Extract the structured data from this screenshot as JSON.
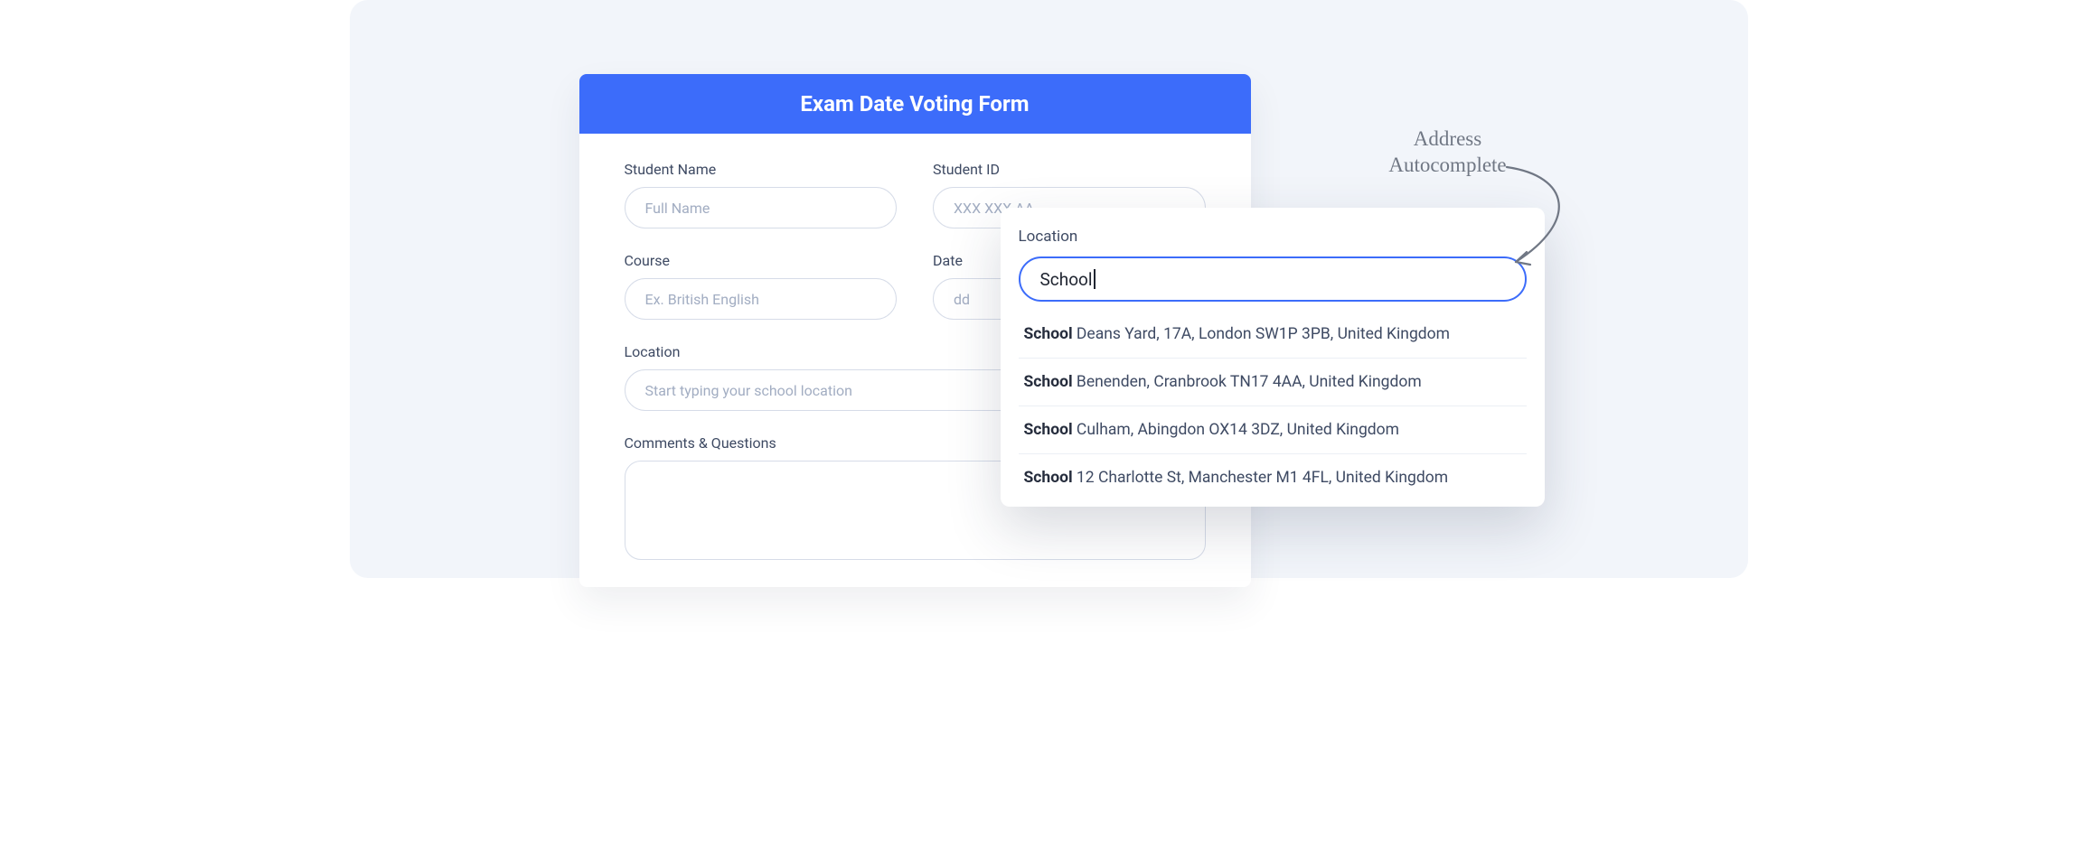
{
  "form": {
    "title": "Exam Date Voting Form",
    "fields": {
      "student_name": {
        "label": "Student Name",
        "placeholder": "Full Name"
      },
      "student_id": {
        "label": "Student ID",
        "placeholder": "XXX XXX AA"
      },
      "course": {
        "label": "Course",
        "placeholder": "Ex. British English"
      },
      "date": {
        "label": "Date",
        "placeholder": "dd"
      },
      "location": {
        "label": "Location",
        "placeholder": "Start typing your school location"
      },
      "comments": {
        "label": "Comments & Questions"
      }
    }
  },
  "autocomplete": {
    "label": "Location",
    "query": "School",
    "suggestions": [
      {
        "match": "School",
        "rest": " Deans Yard, 17A, London SW1P 3PB, United Kingdom"
      },
      {
        "match": "School",
        "rest": " Benenden, Cranbrook TN17 4AA, United Kingdom"
      },
      {
        "match": "School",
        "rest": " Culham, Abingdon OX14 3DZ, United Kingdom"
      },
      {
        "match": "School",
        "rest": " 12 Charlotte St, Manchester M1 4FL, United Kingdom"
      }
    ]
  },
  "annotation": {
    "line1": "Address",
    "line2": "Autocomplete"
  }
}
